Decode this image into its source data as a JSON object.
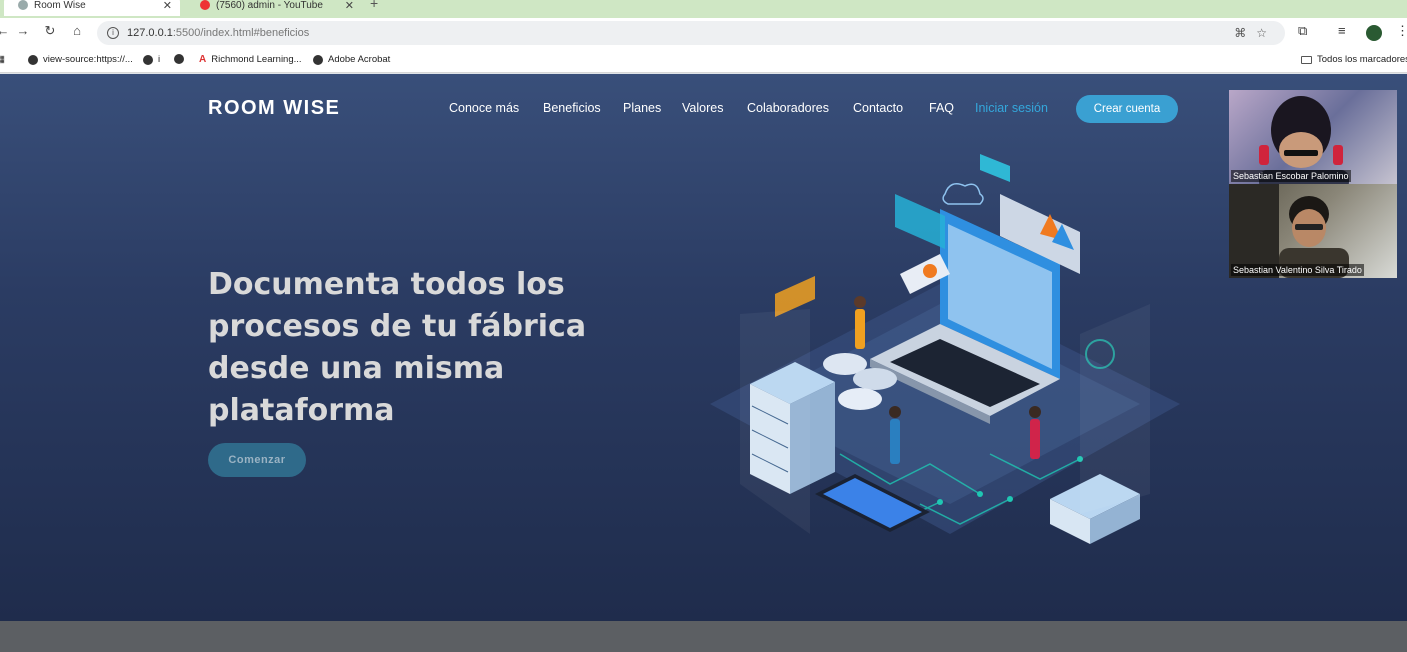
{
  "browser": {
    "tabs": [
      {
        "title": "Room Wise",
        "active": true
      },
      {
        "title": "(7560) admin - YouTube",
        "active": false
      }
    ],
    "url_host": "127.0.0.1",
    "url_rest": ":5500/index.html#beneficios",
    "bookmarks": [
      "view-source:https://...",
      "i",
      "Richmond Learning...",
      "Adobe Acrobat"
    ],
    "all_bookmarks": "Todos los marcadores"
  },
  "site": {
    "logo": "ROOM WISE",
    "nav": [
      "Conoce más",
      "Beneficios",
      "Planes",
      "Valores",
      "Colaboradores",
      "Contacto",
      "FAQ"
    ],
    "login": "Iniciar sesión",
    "signup": "Crear cuenta",
    "headline_lines": [
      "Documenta todos los",
      "procesos de tu fábrica",
      "desde una misma",
      "plataforma"
    ],
    "start_button": "Comenzar"
  },
  "participants": [
    "Sebastian Escobar Palomino",
    "Sebastian Valentino Silva Tirado"
  ],
  "colors": {
    "accent": "#3aa0d2",
    "background_top": "#394f7a",
    "background_bottom": "#1f2c4c"
  }
}
